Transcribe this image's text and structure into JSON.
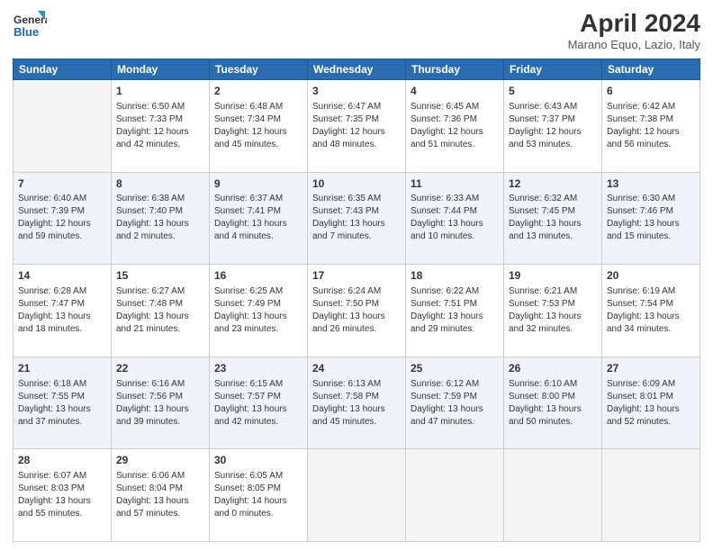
{
  "logo": {
    "text_general": "General",
    "text_blue": "Blue"
  },
  "header": {
    "title": "April 2024",
    "subtitle": "Marano Equo, Lazio, Italy"
  },
  "weekdays": [
    "Sunday",
    "Monday",
    "Tuesday",
    "Wednesday",
    "Thursday",
    "Friday",
    "Saturday"
  ],
  "weeks": [
    [
      {
        "day": "",
        "info": ""
      },
      {
        "day": "1",
        "info": "Sunrise: 6:50 AM\nSunset: 7:33 PM\nDaylight: 12 hours\nand 42 minutes."
      },
      {
        "day": "2",
        "info": "Sunrise: 6:48 AM\nSunset: 7:34 PM\nDaylight: 12 hours\nand 45 minutes."
      },
      {
        "day": "3",
        "info": "Sunrise: 6:47 AM\nSunset: 7:35 PM\nDaylight: 12 hours\nand 48 minutes."
      },
      {
        "day": "4",
        "info": "Sunrise: 6:45 AM\nSunset: 7:36 PM\nDaylight: 12 hours\nand 51 minutes."
      },
      {
        "day": "5",
        "info": "Sunrise: 6:43 AM\nSunset: 7:37 PM\nDaylight: 12 hours\nand 53 minutes."
      },
      {
        "day": "6",
        "info": "Sunrise: 6:42 AM\nSunset: 7:38 PM\nDaylight: 12 hours\nand 56 minutes."
      }
    ],
    [
      {
        "day": "7",
        "info": "Sunrise: 6:40 AM\nSunset: 7:39 PM\nDaylight: 12 hours\nand 59 minutes."
      },
      {
        "day": "8",
        "info": "Sunrise: 6:38 AM\nSunset: 7:40 PM\nDaylight: 13 hours\nand 2 minutes."
      },
      {
        "day": "9",
        "info": "Sunrise: 6:37 AM\nSunset: 7:41 PM\nDaylight: 13 hours\nand 4 minutes."
      },
      {
        "day": "10",
        "info": "Sunrise: 6:35 AM\nSunset: 7:43 PM\nDaylight: 13 hours\nand 7 minutes."
      },
      {
        "day": "11",
        "info": "Sunrise: 6:33 AM\nSunset: 7:44 PM\nDaylight: 13 hours\nand 10 minutes."
      },
      {
        "day": "12",
        "info": "Sunrise: 6:32 AM\nSunset: 7:45 PM\nDaylight: 13 hours\nand 13 minutes."
      },
      {
        "day": "13",
        "info": "Sunrise: 6:30 AM\nSunset: 7:46 PM\nDaylight: 13 hours\nand 15 minutes."
      }
    ],
    [
      {
        "day": "14",
        "info": "Sunrise: 6:28 AM\nSunset: 7:47 PM\nDaylight: 13 hours\nand 18 minutes."
      },
      {
        "day": "15",
        "info": "Sunrise: 6:27 AM\nSunset: 7:48 PM\nDaylight: 13 hours\nand 21 minutes."
      },
      {
        "day": "16",
        "info": "Sunrise: 6:25 AM\nSunset: 7:49 PM\nDaylight: 13 hours\nand 23 minutes."
      },
      {
        "day": "17",
        "info": "Sunrise: 6:24 AM\nSunset: 7:50 PM\nDaylight: 13 hours\nand 26 minutes."
      },
      {
        "day": "18",
        "info": "Sunrise: 6:22 AM\nSunset: 7:51 PM\nDaylight: 13 hours\nand 29 minutes."
      },
      {
        "day": "19",
        "info": "Sunrise: 6:21 AM\nSunset: 7:53 PM\nDaylight: 13 hours\nand 32 minutes."
      },
      {
        "day": "20",
        "info": "Sunrise: 6:19 AM\nSunset: 7:54 PM\nDaylight: 13 hours\nand 34 minutes."
      }
    ],
    [
      {
        "day": "21",
        "info": "Sunrise: 6:18 AM\nSunset: 7:55 PM\nDaylight: 13 hours\nand 37 minutes."
      },
      {
        "day": "22",
        "info": "Sunrise: 6:16 AM\nSunset: 7:56 PM\nDaylight: 13 hours\nand 39 minutes."
      },
      {
        "day": "23",
        "info": "Sunrise: 6:15 AM\nSunset: 7:57 PM\nDaylight: 13 hours\nand 42 minutes."
      },
      {
        "day": "24",
        "info": "Sunrise: 6:13 AM\nSunset: 7:58 PM\nDaylight: 13 hours\nand 45 minutes."
      },
      {
        "day": "25",
        "info": "Sunrise: 6:12 AM\nSunset: 7:59 PM\nDaylight: 13 hours\nand 47 minutes."
      },
      {
        "day": "26",
        "info": "Sunrise: 6:10 AM\nSunset: 8:00 PM\nDaylight: 13 hours\nand 50 minutes."
      },
      {
        "day": "27",
        "info": "Sunrise: 6:09 AM\nSunset: 8:01 PM\nDaylight: 13 hours\nand 52 minutes."
      }
    ],
    [
      {
        "day": "28",
        "info": "Sunrise: 6:07 AM\nSunset: 8:03 PM\nDaylight: 13 hours\nand 55 minutes."
      },
      {
        "day": "29",
        "info": "Sunrise: 6:06 AM\nSunset: 8:04 PM\nDaylight: 13 hours\nand 57 minutes."
      },
      {
        "day": "30",
        "info": "Sunrise: 6:05 AM\nSunset: 8:05 PM\nDaylight: 14 hours\nand 0 minutes."
      },
      {
        "day": "",
        "info": ""
      },
      {
        "day": "",
        "info": ""
      },
      {
        "day": "",
        "info": ""
      },
      {
        "day": "",
        "info": ""
      }
    ]
  ]
}
